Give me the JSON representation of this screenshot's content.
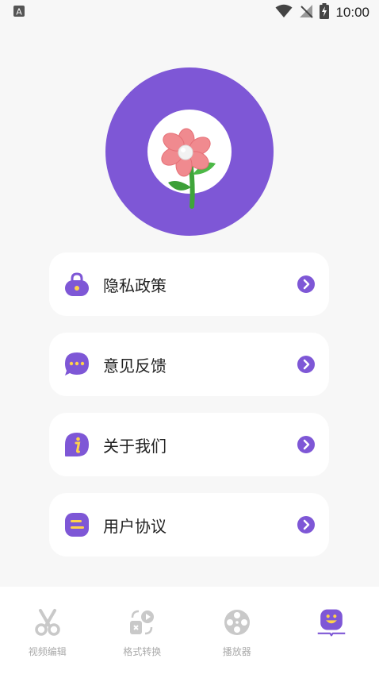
{
  "status_bar": {
    "time": "10:00"
  },
  "menu": {
    "items": [
      {
        "label": "隐私政策",
        "icon": "lock-icon"
      },
      {
        "label": "意见反馈",
        "icon": "chat-bubble-icon"
      },
      {
        "label": "关于我们",
        "icon": "info-icon"
      },
      {
        "label": "用户协议",
        "icon": "agreement-icon"
      }
    ]
  },
  "tabbar": {
    "items": [
      {
        "label": "视频编辑",
        "icon": "scissors-icon"
      },
      {
        "label": "格式转换",
        "icon": "convert-icon"
      },
      {
        "label": "播放器",
        "icon": "film-reel-icon"
      },
      {
        "label": "",
        "icon": "smiley-icon"
      }
    ]
  },
  "colors": {
    "accent": "#7e57d6",
    "background": "#f7f7f7",
    "inactive": "#c9c9c9",
    "icon_yellow": "#ffd24a"
  }
}
